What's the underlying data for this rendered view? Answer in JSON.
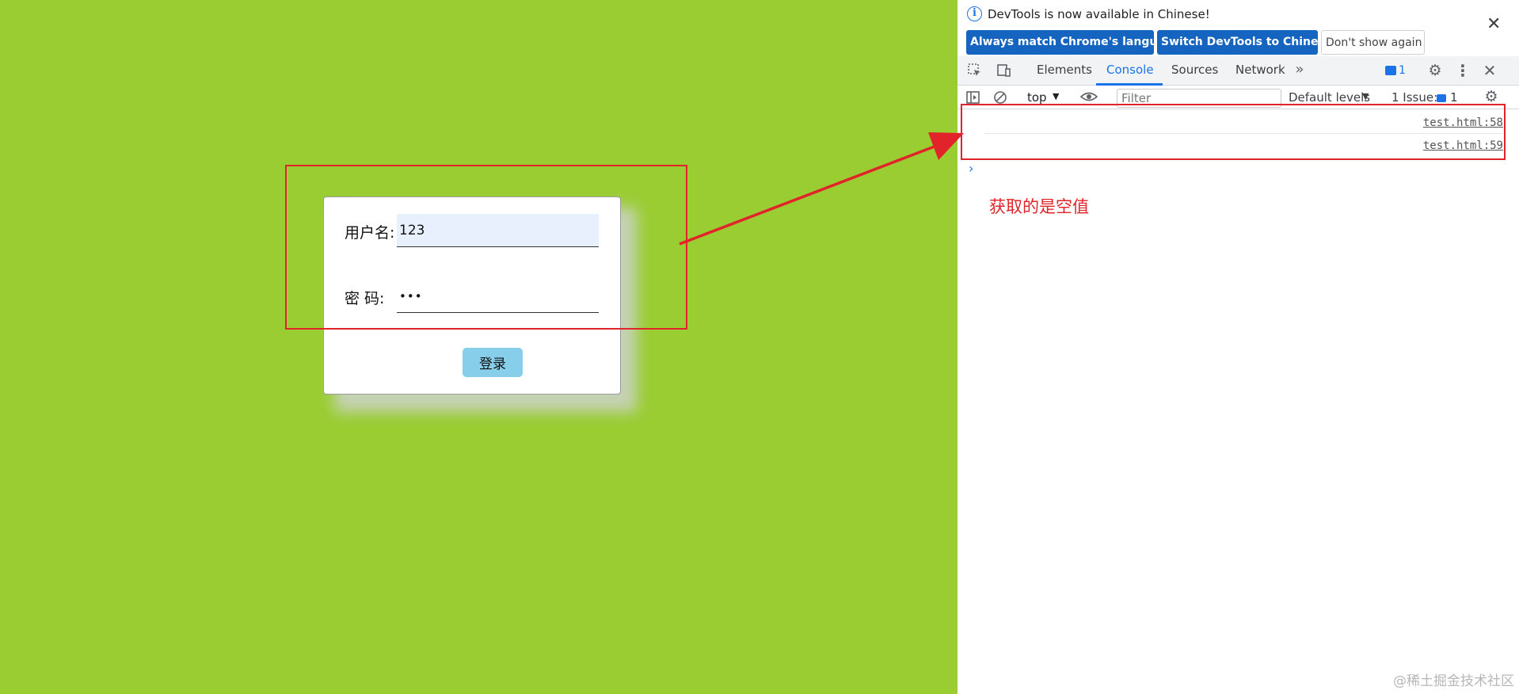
{
  "login": {
    "username_label": "用户名:",
    "username_value": "123",
    "password_label": "密 码:",
    "password_value": "123",
    "login_button": "登录"
  },
  "devtools": {
    "infobar": {
      "message": "DevTools is now available in Chinese!",
      "info_icon": "i",
      "close_icon": "✕",
      "match_language_button": "Always match Chrome's language",
      "switch_language_button": "Switch DevTools to Chinese",
      "dont_show_button": "Don't show again"
    },
    "tabs": {
      "elements": "Elements",
      "console": "Console",
      "sources": "Sources",
      "network": "Network",
      "more_icon": "»",
      "issues_count": "1"
    },
    "toolbar": {
      "context": "top",
      "filter_placeholder": "Filter",
      "default_levels": "Default levels",
      "issues_label": "1 Issue:",
      "issues_count": "1"
    },
    "console_rows": [
      {
        "source": "test.html:58"
      },
      {
        "source": "test.html:59"
      }
    ],
    "prompt_icon": "›"
  },
  "annotation": {
    "text": "获取的是空值",
    "color": "#e0242a"
  },
  "watermark": "@稀土掘金技术社区",
  "colors": {
    "page_background": "#9acd32",
    "autofill_background": "#e8f0fe",
    "login_button": "#87ceeb",
    "devtools_accent": "#1a73e8",
    "infobar_button": "#1565c0"
  }
}
